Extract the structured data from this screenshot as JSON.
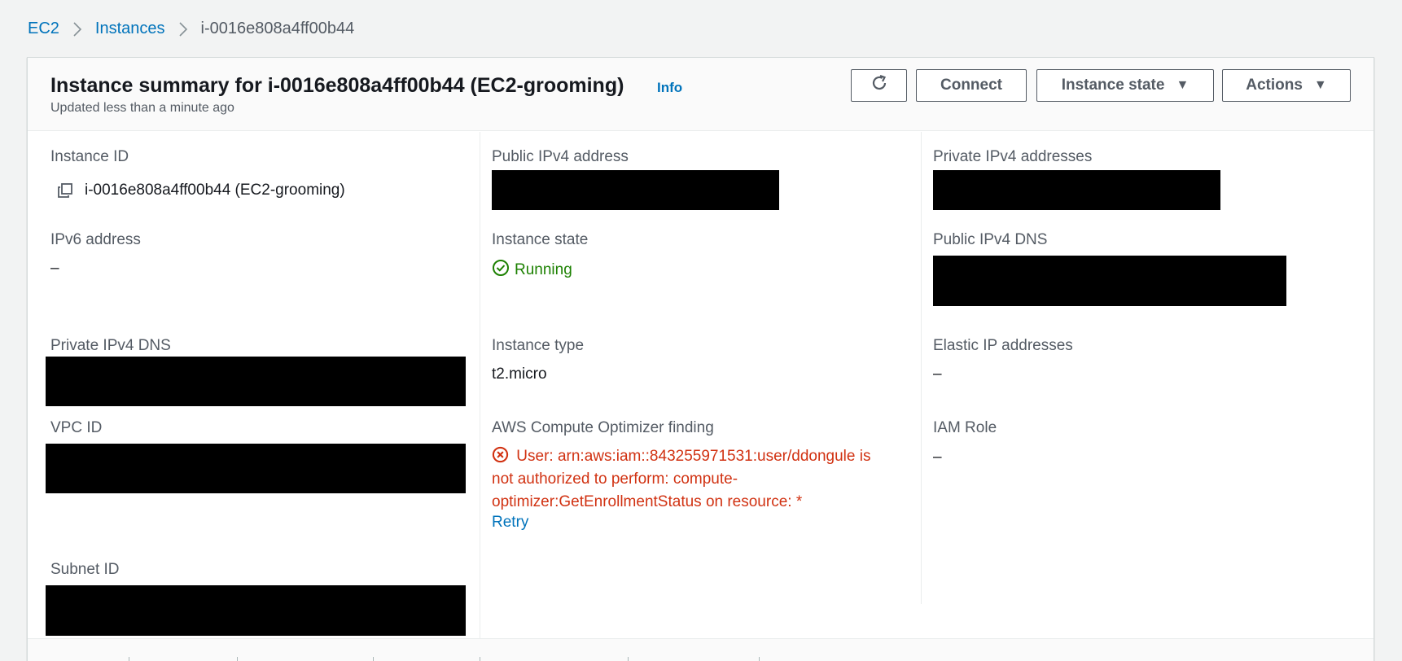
{
  "breadcrumb": {
    "items": [
      "EC2",
      "Instances"
    ],
    "current": "i-0016e808a4ff00b44"
  },
  "header": {
    "title": "Instance summary for i-0016e808a4ff00b44 (EC2-grooming)",
    "info": "Info",
    "subtitle": "Updated less than a minute ago",
    "buttons": {
      "refresh_icon": "refresh-icon",
      "connect": "Connect",
      "instance_state": "Instance state",
      "actions": "Actions"
    }
  },
  "details": {
    "instance_id": {
      "label": "Instance ID",
      "value": "i-0016e808a4ff00b44 (EC2-grooming)"
    },
    "ipv6": {
      "label": "IPv6 address",
      "value": "–"
    },
    "private_dns": {
      "label": "Private IPv4 DNS"
    },
    "vpc_id": {
      "label": "VPC ID"
    },
    "subnet_id": {
      "label": "Subnet ID"
    },
    "public_ipv4": {
      "label": "Public IPv4 address"
    },
    "instance_state": {
      "label": "Instance state",
      "value": "Running"
    },
    "instance_type": {
      "label": "Instance type",
      "value": "t2.micro"
    },
    "optimizer": {
      "label": "AWS Compute Optimizer finding",
      "error": "User: arn:aws:iam::843255971531:user/ddongule is not authorized to perform: compute-optimizer:GetEnrollmentStatus on resource: *",
      "retry": "Retry"
    },
    "private_ipv4": {
      "label": "Private IPv4 addresses"
    },
    "public_dns": {
      "label": "Public IPv4 DNS"
    },
    "elastic_ip": {
      "label": "Elastic IP addresses",
      "value": "–"
    },
    "iam_role": {
      "label": "IAM Role",
      "value": "–"
    }
  },
  "colors": {
    "link": "#0073bb",
    "success": "#1d8102",
    "error": "#d13212"
  }
}
